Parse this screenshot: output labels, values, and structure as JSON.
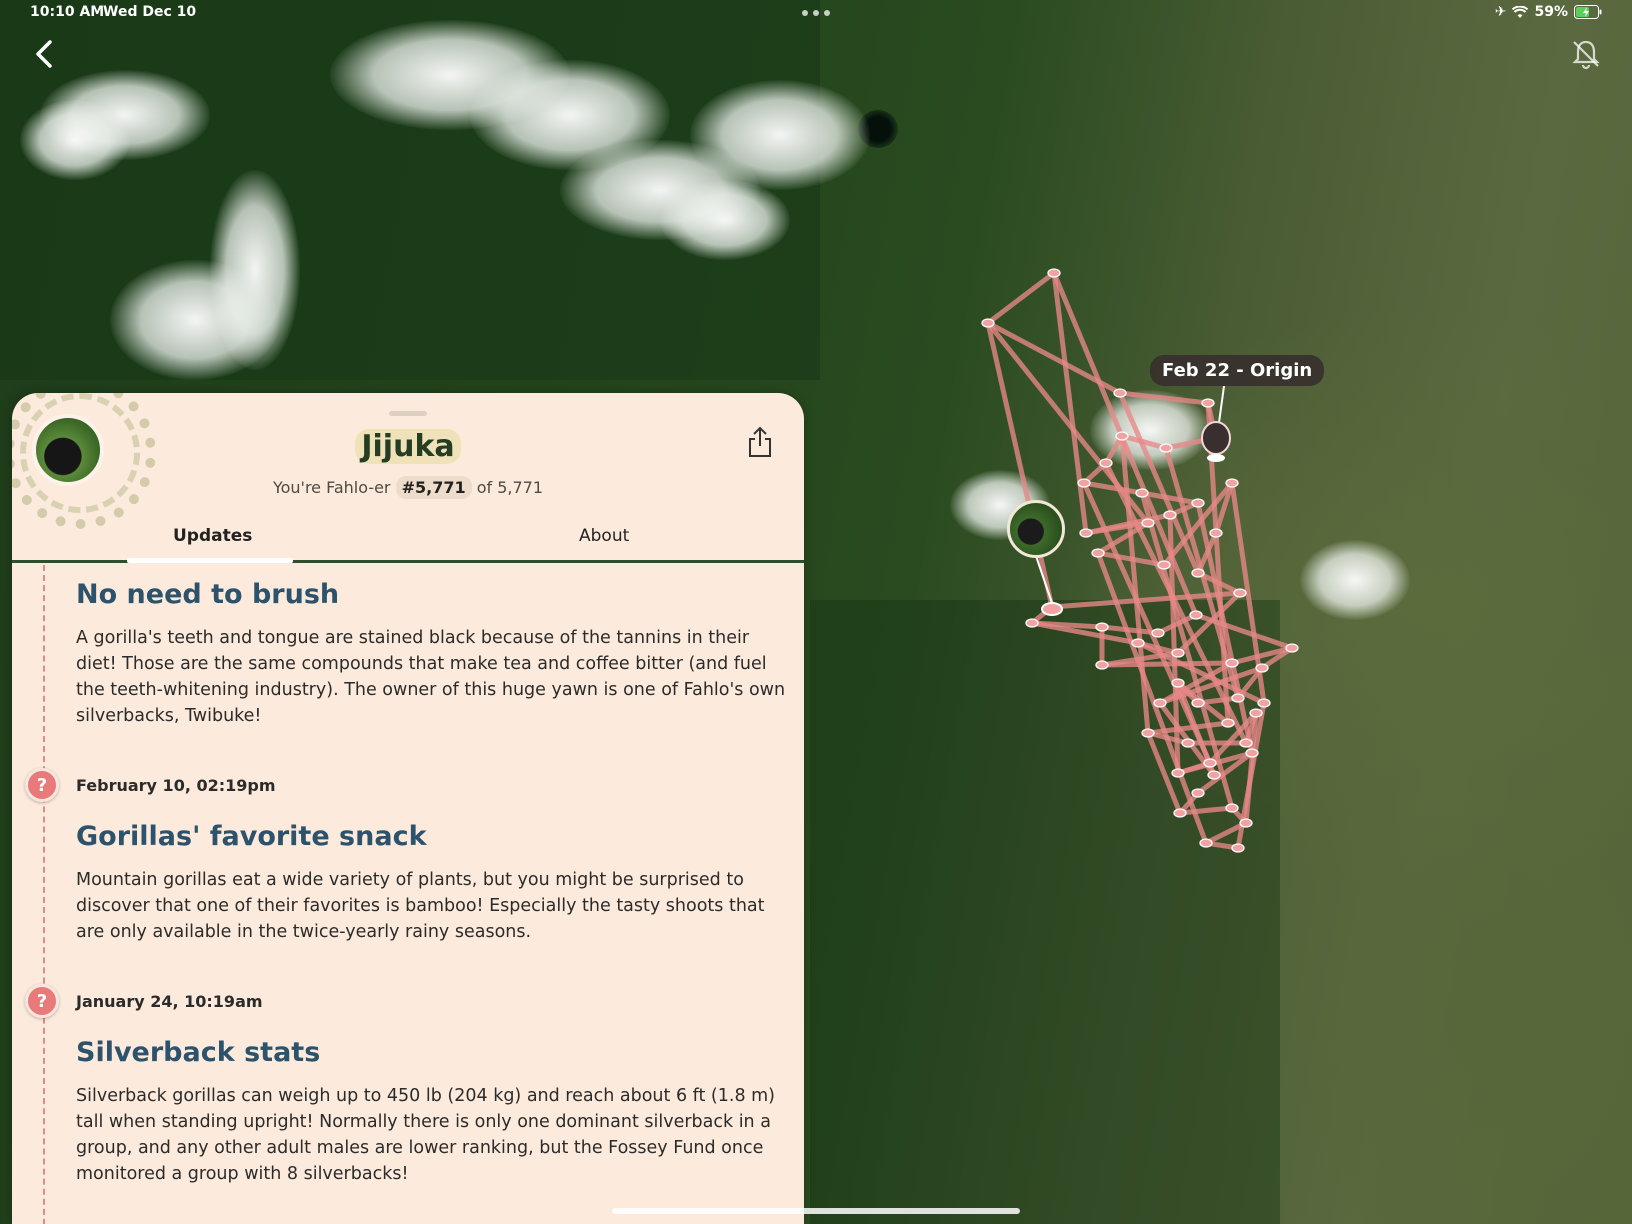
{
  "status_bar": {
    "time": "10:10 AM",
    "date": "Wed Dec 10",
    "battery": "59%",
    "icons": [
      "airplane-icon",
      "wifi-icon",
      "battery-charging-icon"
    ]
  },
  "navigation": {
    "back_icon": "chevron-left-icon",
    "notify_icon": "bell-off-icon"
  },
  "map": {
    "origin_label": "Feb 22 - Origin",
    "track_color": "#e88888"
  },
  "profile": {
    "name": "Jijuka",
    "rank_prefix": "You're Fahlo-er",
    "rank": "#5,771",
    "rank_suffix": "of 5,771",
    "share_icon": "share-icon"
  },
  "tabs": [
    {
      "label": "Updates",
      "active": true
    },
    {
      "label": "About",
      "active": false
    }
  ],
  "updates": [
    {
      "date": "",
      "title": "No need to brush",
      "body": "A gorilla's teeth and tongue are stained black because of the tannins in their diet! Those are the same compounds that make tea and coffee bitter (and fuel the teeth-whitening industry). The owner of this huge yawn is one of Fahlo's own silverbacks, Twibuke!"
    },
    {
      "date": "February 10, 02:19pm",
      "marker": "?",
      "title": "Gorillas' favorite snack",
      "body": "Mountain gorillas eat a wide variety of plants, but you might be surprised to discover that one of their favorites is bamboo! Especially the tasty shoots that are only available in the twice-yearly rainy seasons."
    },
    {
      "date": "January 24, 10:19am",
      "marker": "?",
      "title": "Silverback stats",
      "body": "Silverback gorillas can weigh up to 450 lb (204 kg) and reach about 6 ft (1.8 m) tall when standing upright! Normally there is only one dominant silverback in a group, and any other adult males are lower ranking, but the Fossey Fund once monitored a group with 8 silverbacks!"
    }
  ],
  "colors": {
    "panel_bg": "#fcebdc",
    "title_blue": "#2c526c",
    "marker_red": "#e87a7a",
    "name_green": "#243d23"
  }
}
